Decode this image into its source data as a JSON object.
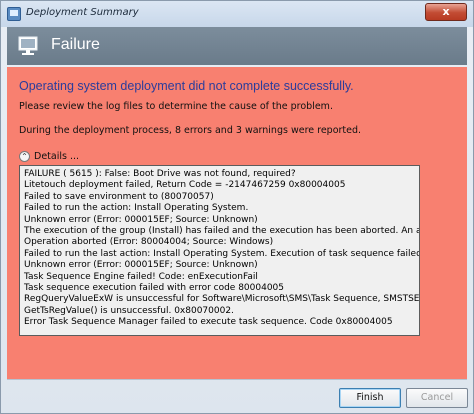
{
  "window": {
    "title": "Deployment Summary",
    "close_label": "x"
  },
  "header": {
    "title": "Failure",
    "icon": "computer-monitor-icon"
  },
  "summary": {
    "headline": "Operating system deployment did not complete successfully.",
    "message1": "Please review the log files to determine the cause of the problem.",
    "message2": "During the deployment process, 8 errors and 3 warnings were reported."
  },
  "details": {
    "toggle_label": "Details ...",
    "lines": [
      "FAILURE ( 5615 ): False: Boot Drive was not found, required?",
      "Litetouch deployment failed, Return Code = -2147467259  0x80004005",
      "Failed to save environment to  (80070057)",
      "Failed to run the action: Install Operating System.",
      "Unknown error (Error: 000015EF; Source: Unknown)",
      "The execution of the group (Install) has failed and the execution has been aborted. An action failed.",
      "Operation aborted (Error: 80004004; Source: Windows)",
      "Failed to run the last action: Install Operating System. Execution of task sequence failed.",
      "Unknown error (Error: 000015EF; Source: Unknown)",
      "Task Sequence Engine failed! Code: enExecutionFail",
      "Task sequence execution failed with error code 80004005",
      "RegQueryValueExW is unsuccessful for Software\\Microsoft\\SMS\\Task Sequence, SMSTSEndProgram",
      "GetTsRegValue() is unsuccessful. 0x80070002.",
      "Error Task Sequence Manager failed to execute task sequence. Code 0x80004005"
    ]
  },
  "buttons": {
    "finish": "Finish",
    "cancel": "Cancel"
  },
  "colors": {
    "panel_background": "#f88070",
    "header_background": "#6f808f",
    "headline_text": "#2b3c9b"
  }
}
